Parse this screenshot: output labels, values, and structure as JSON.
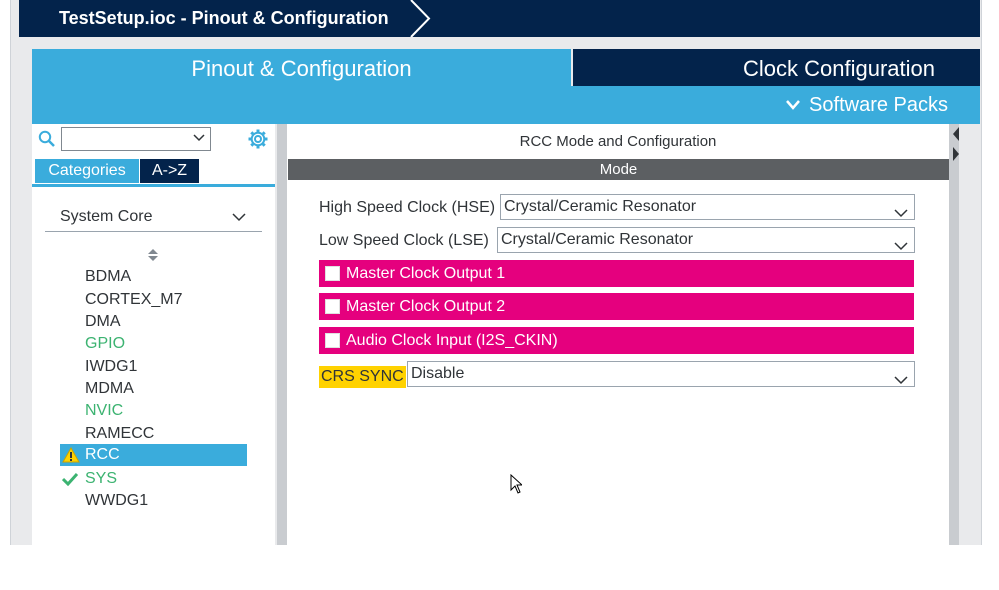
{
  "window": {
    "title": "TestSetup.ioc - Pinout & Configuration"
  },
  "tabs": {
    "pinout": "Pinout & Configuration",
    "clock": "Clock Configuration"
  },
  "subbar": {
    "software_packs": "Software Packs"
  },
  "left": {
    "search": {
      "value": "",
      "placeholder": ""
    },
    "category_tabs": [
      "Categories",
      "A->Z"
    ],
    "group": "System Core",
    "items": [
      {
        "label": "BDMA",
        "status": "none"
      },
      {
        "label": "CORTEX_M7",
        "status": "none"
      },
      {
        "label": "DMA",
        "status": "none"
      },
      {
        "label": "GPIO",
        "status": "configured"
      },
      {
        "label": "IWDG1",
        "status": "none"
      },
      {
        "label": "MDMA",
        "status": "none"
      },
      {
        "label": "NVIC",
        "status": "configured"
      },
      {
        "label": "RAMECC",
        "status": "none"
      },
      {
        "label": "RCC",
        "status": "warning",
        "selected": true
      },
      {
        "label": "SYS",
        "status": "ok"
      },
      {
        "label": "WWDG1",
        "status": "none"
      }
    ]
  },
  "right": {
    "title": "RCC Mode and Configuration",
    "section": "Mode",
    "hse": {
      "label": "High Speed Clock (HSE)",
      "value": "Crystal/Ceramic Resonator"
    },
    "lse": {
      "label": "Low Speed Clock (LSE)",
      "value": "Crystal/Ceramic Resonator"
    },
    "checkboxes": [
      {
        "label": "Master Clock Output 1",
        "checked": false
      },
      {
        "label": "Master Clock Output 2",
        "checked": false
      },
      {
        "label": "Audio Clock Input (I2S_CKIN)",
        "checked": false
      }
    ],
    "crs_sync": {
      "label": "CRS SYNC",
      "value": "Disable"
    }
  },
  "colors": {
    "navy": "#03234b",
    "accent_blue": "#3aacdc",
    "pink": "#e5007e",
    "yellow": "#ffd200",
    "green": "#3cb371"
  }
}
